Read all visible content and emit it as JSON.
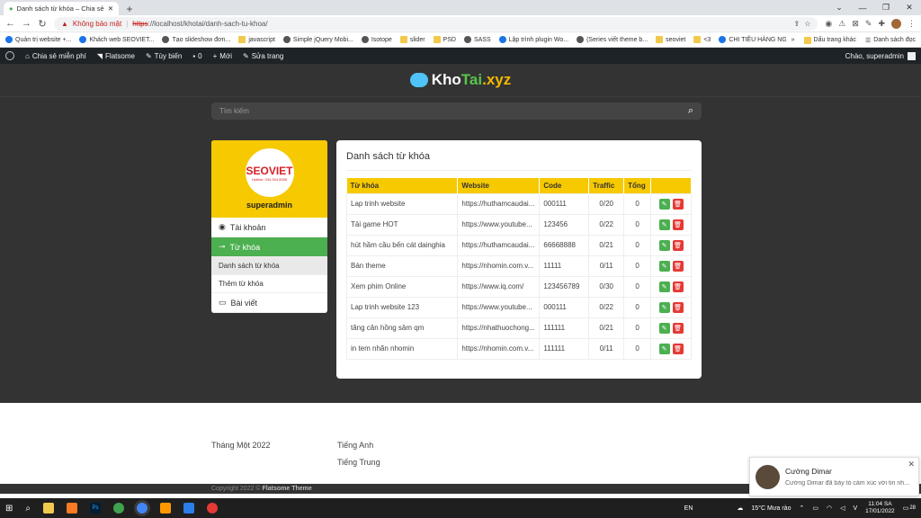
{
  "browser": {
    "tab_title": "Danh sách từ khóa – Chia sẻ miễn",
    "security_warning": "Không bảo mật",
    "url_scheme": "https",
    "url_rest": "://localhost/khotai/danh-sach-tu-khoa/",
    "bookmarks": [
      "Quản trị website +...",
      "Khách web SEOVIET...",
      "Tạo slideshow đơn...",
      "javascript",
      "Simple jQuery Mobi...",
      "Isotope",
      "slider",
      "PSD",
      "SASS",
      "Lập trình plugin Wo...",
      "(Series viết theme b...",
      "seoviet",
      "<3",
      "CHI TIÊU HÀNG NG..."
    ],
    "bookmarks_more": "»",
    "other_bookmarks": "Dấu trang khác",
    "reading_list": "Danh sách đọc"
  },
  "wp_admin": {
    "site": "Chia sẻ miễn phí",
    "theme": "Flatsome",
    "customize": "Tùy biến",
    "comments_count": "0",
    "new": "Mới",
    "edit_page": "Sửa trang",
    "greeting": "Chào, superadmin"
  },
  "header": {
    "logo_part1": "Kho",
    "logo_part2": "Tai",
    "logo_part3": ".xyz"
  },
  "search": {
    "placeholder": "Tìm kiếm"
  },
  "sidebar": {
    "brand": "SEOVIET",
    "hotline": "Hotline: 034.304.5555",
    "username": "superadmin",
    "items": [
      {
        "label": "Tài khoản"
      },
      {
        "label": "Từ khóa"
      },
      {
        "label": "Danh sách từ khóa"
      },
      {
        "label": "Thêm từ khóa"
      },
      {
        "label": "Bài viết"
      }
    ]
  },
  "content": {
    "title": "Danh sách từ khóa",
    "columns": [
      "Từ khóa",
      "Website",
      "Code",
      "Traffic",
      "Tổng"
    ],
    "rows": [
      [
        "Lap trinh website",
        "https://huthamcaudai...",
        "000111",
        "0/20",
        "0"
      ],
      [
        "Tải game HOT",
        "https://www.youtube...",
        "123456",
        "0/22",
        "0"
      ],
      [
        "hút hầm cầu bến cát dainghia",
        "https://huthamcaudai...",
        "66668888",
        "0/21",
        "0"
      ],
      [
        "Bán theme",
        "https://nhomin.com.v...",
        "11111",
        "0/11",
        "0"
      ],
      [
        "Xem phim Online",
        "https://www.iq.com/",
        "123456789",
        "0/30",
        "0"
      ],
      [
        "Lap trinh website 123",
        "https://www.youtube...",
        "000111",
        "0/22",
        "0"
      ],
      [
        "tăng cân hồng sâm qm",
        "https://nhathuochong...",
        "111111",
        "0/21",
        "0"
      ],
      [
        "in tem nhãn nhomin",
        "https://nhomin.com.v...",
        "111111",
        "0/11",
        "0"
      ]
    ]
  },
  "footer": {
    "archive": "Tháng Một 2022",
    "languages": [
      "Tiếng Anh",
      "Tiếng Trung"
    ],
    "copyright": "Copyright 2022 ©",
    "copyright_theme": "Flatsome Theme"
  },
  "notification": {
    "name": "Cường Dimar",
    "text": "Cường Dimar đã bày tỏ cảm xúc với tin nh..."
  },
  "taskbar": {
    "lang": "EN",
    "weather": "15°C  Mưa rào",
    "time": "11:04 SA",
    "date": "17/01/2022",
    "notif_count": "28"
  }
}
